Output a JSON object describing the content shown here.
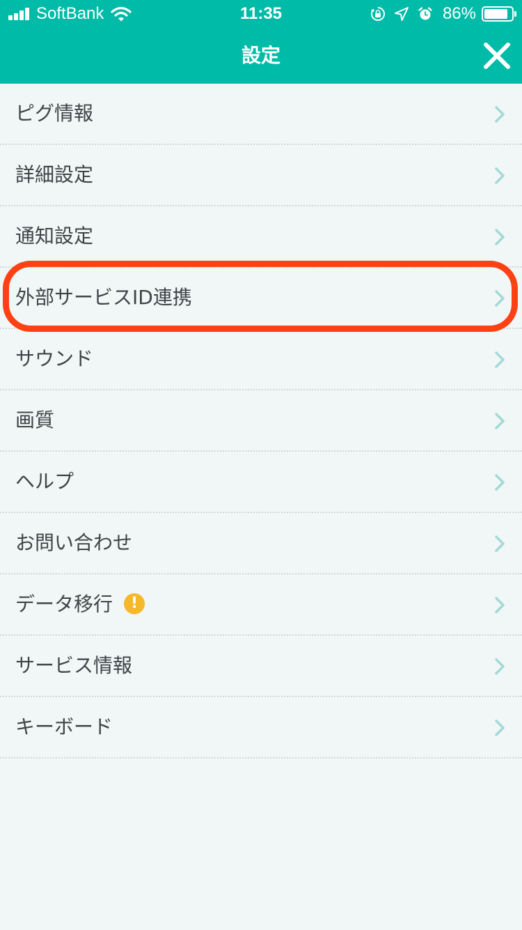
{
  "status_bar": {
    "carrier": "SoftBank",
    "time": "11:35",
    "battery_percent": "86%",
    "battery_level": 0.86,
    "icons": [
      "signal-bars-icon",
      "wifi-icon",
      "orientation-lock-icon",
      "location-arrow-icon",
      "alarm-icon",
      "battery-icon"
    ]
  },
  "nav": {
    "title": "設定",
    "close_icon": "close-icon"
  },
  "menu": {
    "items": [
      {
        "label": "ピグ情報"
      },
      {
        "label": "詳細設定"
      },
      {
        "label": "通知設定"
      },
      {
        "label": "外部サービスID連携",
        "highlighted": true
      },
      {
        "label": "サウンド"
      },
      {
        "label": "画質"
      },
      {
        "label": "ヘルプ"
      },
      {
        "label": "お問い合わせ"
      },
      {
        "label": "データ移行",
        "badge": "!"
      },
      {
        "label": "サービス情報"
      },
      {
        "label": "キーボード"
      }
    ],
    "chevron_icon": "chevron-right-icon"
  },
  "colors": {
    "header": "#00bba7",
    "background": "#f1f6f6",
    "text": "#3f4447",
    "chevron": "#a3dad6",
    "highlight_outline": "#fd4114",
    "warning_badge": "#f5b829"
  }
}
